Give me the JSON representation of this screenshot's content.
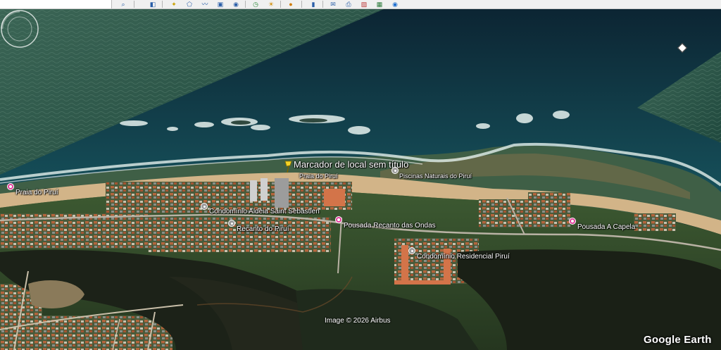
{
  "toolbar": {
    "search_placeholder": "",
    "buttons": [
      {
        "name": "search-icon",
        "glyph": "⌕"
      },
      {
        "name": "sidebar-toggle-icon",
        "glyph": "◧"
      },
      {
        "name": "add-placemark-icon",
        "glyph": "✦"
      },
      {
        "name": "add-polygon-icon",
        "glyph": "⬠"
      },
      {
        "name": "add-path-icon",
        "glyph": "〰"
      },
      {
        "name": "add-image-overlay-icon",
        "glyph": "▣"
      },
      {
        "name": "record-tour-icon",
        "glyph": "◉"
      },
      {
        "name": "historical-imagery-icon",
        "glyph": "◷"
      },
      {
        "name": "sunlight-icon",
        "glyph": "☀"
      },
      {
        "name": "switch-planet-icon",
        "glyph": "●"
      },
      {
        "name": "ruler-icon",
        "glyph": "▮"
      },
      {
        "name": "email-icon",
        "glyph": "✉"
      },
      {
        "name": "print-icon",
        "glyph": "⎙"
      },
      {
        "name": "save-image-icon",
        "glyph": "▨"
      },
      {
        "name": "view-in-maps-icon",
        "glyph": "▦"
      },
      {
        "name": "earth-icon",
        "glyph": "◉"
      }
    ]
  },
  "map": {
    "placemark_label": "Marcador de local sem título",
    "places": {
      "praia_do_pirui_left": "Praia do Piruí",
      "praia_do_pirui_center": "Praia do Piruí",
      "piscinas_naturais": "Piscinas Naturais do Piruí",
      "condominio_aldeia": "Condomínio Aldeia Saint Sebastien",
      "recanto_do_pirui": "Recanto do Piruí",
      "pousada_recanto": "Pousada Recanto das Ondas",
      "pousada_capela": "Pousada A Capela",
      "condominio_residencial": "Condomínio Residencial Piruí"
    },
    "credit": "Image © 2026 Airbus",
    "brand": "Google Earth"
  },
  "colors": {
    "ocean_deep": "#0d2f3d",
    "ocean_mid": "#17505a",
    "ocean_swell": "#2d5a4a",
    "surf": "#dfeeea",
    "sand": "#d4b68a",
    "vegetation": "#2f4a28",
    "wetland": "#1d241a",
    "pin_pink": "#e33f9c",
    "pin_grey": "#9a9a9a",
    "placemark_yellow": "#f5d327"
  }
}
